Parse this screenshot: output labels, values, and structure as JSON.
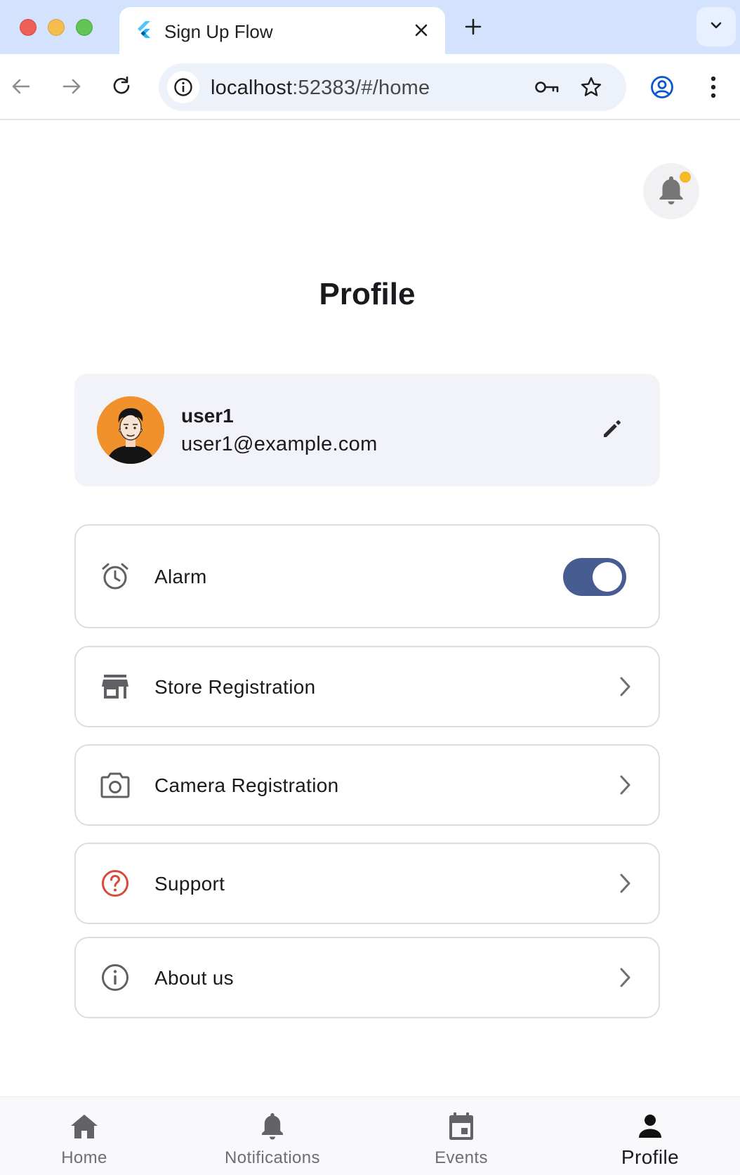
{
  "browser": {
    "tab_title": "Sign Up Flow",
    "url_host": "localhost",
    "url_rest": ":52383/#/home",
    "icons": {
      "favicon": "flutter-logo-icon",
      "close": "close-icon",
      "new_tab": "plus-icon",
      "tab_search": "chevron-down-icon",
      "back": "arrow-left-icon",
      "forward": "arrow-right-icon",
      "reload": "reload-icon",
      "site_info": "info-icon",
      "passwords": "key-icon",
      "bookmark": "star-icon",
      "profile": "account-circle-icon",
      "menu": "more-vert-icon"
    }
  },
  "page": {
    "title": "Profile",
    "notification_dot_color": "#f2b928"
  },
  "user": {
    "name": "user1",
    "email": "user1@example.com",
    "avatar_bg": "#f0912c"
  },
  "settings": {
    "alarm": {
      "label": "Alarm",
      "icon": "alarm-icon",
      "enabled": true
    },
    "items": [
      {
        "label": "Store Registration",
        "icon": "store-icon"
      },
      {
        "label": "Camera Registration",
        "icon": "camera-icon"
      },
      {
        "label": "Support",
        "icon": "help-icon",
        "icon_color": "#d84a38"
      },
      {
        "label": "About us",
        "icon": "info-icon"
      }
    ]
  },
  "bottom_nav": {
    "active": "Profile",
    "accent": "#475d92",
    "tabs": [
      {
        "label": "Home",
        "icon": "home-icon"
      },
      {
        "label": "Notifications",
        "icon": "bell-icon"
      },
      {
        "label": "Events",
        "icon": "event-icon"
      },
      {
        "label": "Profile",
        "icon": "person-icon"
      }
    ]
  }
}
